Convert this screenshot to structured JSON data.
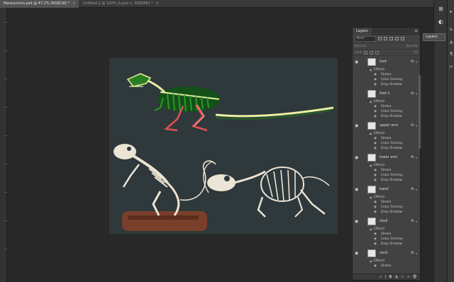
{
  "tabs": [
    {
      "label": "Marasuchus.psd @ 47.2% (RGB/16) *",
      "active": true
    },
    {
      "label": "Untitled-1 @ 100% (Layer 1, RGB/8#) *",
      "active": false
    }
  ],
  "tab_close": "×",
  "layers_panel": {
    "tab_label": "Layers",
    "menu_icon": "≡",
    "kind_label": "Kind",
    "mode_label": "Normal",
    "opacity_label": "Opacity",
    "lock_label": "Lock",
    "fill_label": "Fill",
    "layers": [
      {
        "name": "foot",
        "visible": true,
        "effects_label": "Effects",
        "effects": [
          "Stroke",
          "Color Overlay",
          "Drop Shadow"
        ]
      },
      {
        "name": "foot 2",
        "visible": false,
        "effects_label": "Effects",
        "effects": [
          "Stroke",
          "Color Overlay",
          "Drop Shadow"
        ]
      },
      {
        "name": "upper arm",
        "visible": true,
        "effects_label": "Effects",
        "effects": [
          "Stroke",
          "Color Overlay",
          "Drop Shadow"
        ]
      },
      {
        "name": "lower arm",
        "visible": true,
        "effects_label": "Effects",
        "effects": [
          "Stroke",
          "Color Overlay",
          "Drop Shadow"
        ]
      },
      {
        "name": "hand",
        "visible": true,
        "effects_label": "Effects",
        "effects": [
          "Stroke",
          "Color Overlay",
          "Drop Shadow"
        ]
      },
      {
        "name": "skull",
        "visible": true,
        "effects_label": "Effects",
        "effects": [
          "Stroke",
          "Color Overlay",
          "Drop Shadow"
        ]
      },
      {
        "name": "neck",
        "visible": true,
        "effects_label": "Effects",
        "effects": [
          "Stroke"
        ]
      }
    ],
    "fx_label": "fx"
  },
  "layers_tooltip": "Layers",
  "colors": {
    "canvas_bg": "#2f383b",
    "dino_body": "#1f6e1a",
    "dino_highlight": "#e8f0a0",
    "dino_legs": "#e05050",
    "bone": "#ece4d4",
    "log": "#7a3f2a"
  }
}
